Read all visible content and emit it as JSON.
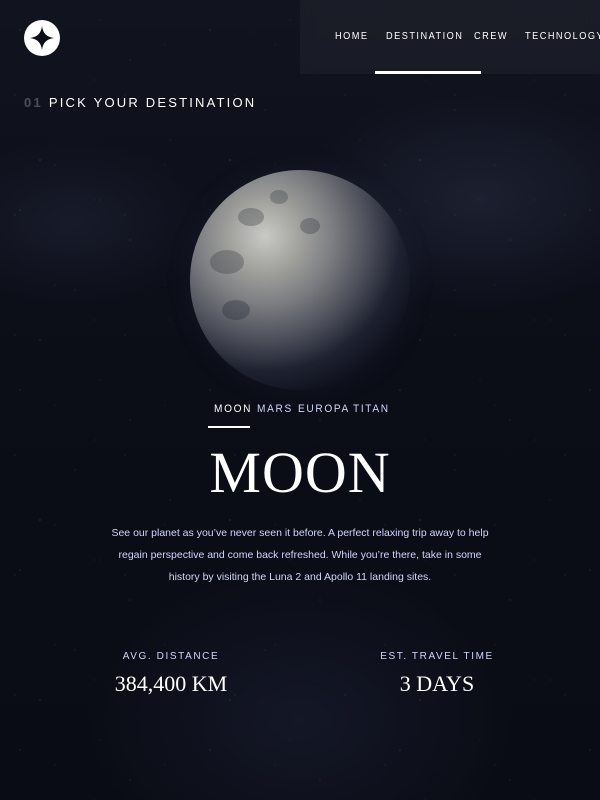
{
  "header": {
    "logo_icon": "star-logo-icon",
    "nav": [
      {
        "number": "",
        "label": "HOME",
        "active": false
      },
      {
        "number": "",
        "label": "DESTINATION",
        "active": true
      },
      {
        "number": "",
        "label": "CREW",
        "active": false
      },
      {
        "number": "",
        "label": "TECHNOLOGY",
        "active": false
      }
    ]
  },
  "page": {
    "number": "01",
    "title": "PICK YOUR DESTINATION"
  },
  "destination": {
    "tabs": [
      {
        "label": "MOON",
        "active": true
      },
      {
        "label": "MARS",
        "active": false
      },
      {
        "label": "EUROPA",
        "active": false
      },
      {
        "label": "TITAN",
        "active": false
      }
    ],
    "name": "MOON",
    "description": "See our planet as you’ve never seen it before. A perfect relaxing trip away to help regain perspective and come back refreshed. While you’re there, take in some history by visiting the Luna 2 and Apollo 11 landing sites.",
    "stats": {
      "distance_label": "AVG. DISTANCE",
      "distance_value": "384,400 KM",
      "travel_label": "EST. TRAVEL TIME",
      "travel_value": "3 DAYS"
    }
  },
  "colors": {
    "background": "#0b0d17",
    "accent_light": "#d0d6f9",
    "white": "#ffffff"
  }
}
